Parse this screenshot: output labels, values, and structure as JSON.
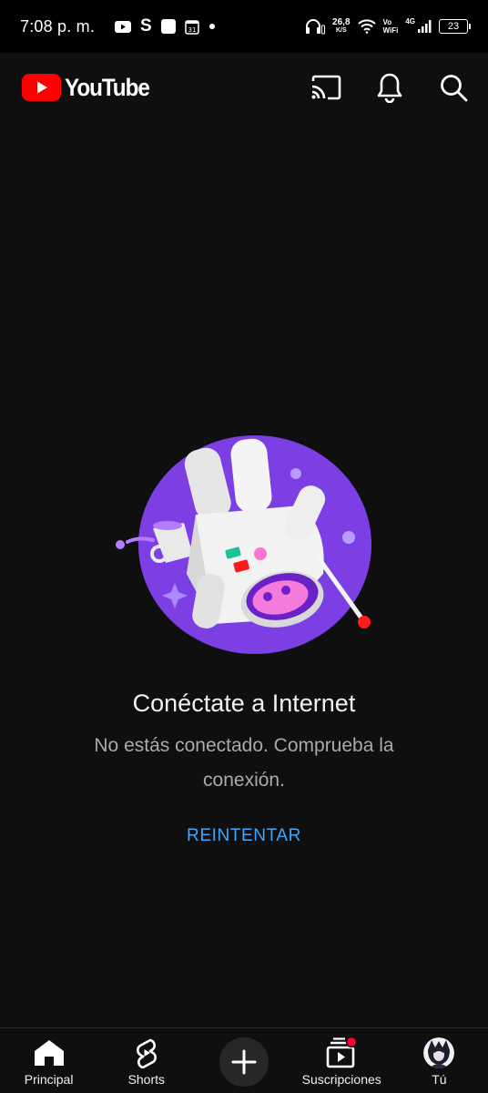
{
  "status_bar": {
    "time": "7:08 p. m.",
    "net_speed": "26,8",
    "net_speed_unit": "K/S",
    "vo_label": "Vo",
    "wifi_label": "WiFi",
    "network_type": "4G",
    "battery": "23"
  },
  "app": {
    "name": "YouTube",
    "brand_color": "#ff0000"
  },
  "offline": {
    "title": "Conéctate a Internet",
    "message": "No estás conectado. Comprueba la conexión.",
    "retry_label": "REINTENTAR",
    "accent": "#3ea6ff"
  },
  "nav": {
    "items": [
      {
        "label": "Principal",
        "icon": "home-icon"
      },
      {
        "label": "Shorts",
        "icon": "shorts-icon"
      },
      {
        "label": "",
        "icon": "create-icon"
      },
      {
        "label": "Suscripciones",
        "icon": "subscriptions-icon"
      },
      {
        "label": "Tú",
        "icon": "avatar"
      }
    ]
  }
}
